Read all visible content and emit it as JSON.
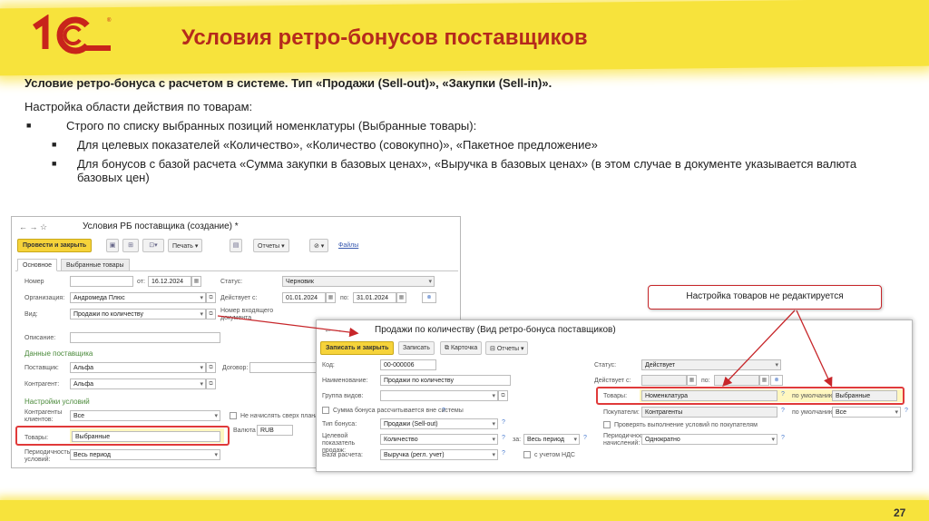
{
  "slide": {
    "title": "Условия ретро-бонусов поставщиков",
    "page_number": "27",
    "brand_colors": {
      "accent_yellow": "#f7e33c",
      "title_red": "#b52a1c",
      "highlight_red": "#e03a3a"
    }
  },
  "logo": {
    "text": "1С",
    "icon": "1c-logo-icon"
  },
  "intro": {
    "bold": "Условие ретро-бонуса с расчетом в системе. Тип «Продажи (Sell-out)», «Закупки (Sell-in)».",
    "para": "Настройка области действия по товарам:",
    "bullet1": "Строго по списку выбранных позиций номенклатуры (Выбранные товары):",
    "sub1": "Для целевых показателей «Количество», «Количество (совокупно)», «Пакетное предложение»",
    "sub2": "Для бонусов с базой расчета «Сумма закупки в базовых ценах», «Выручка в базовых ценах» (в этом случае в документе указывается валюта базовых цен)",
    "bullet_marker": "■"
  },
  "callout": "Настройка товаров не редактируется",
  "win1": {
    "title": "Условия РБ поставщика (создание) *",
    "nav": "←  →  ☆",
    "toolbar": {
      "post_close": "Провести и закрыть",
      "print": "Печать",
      "reports": "Отчеты",
      "files": "Файлы"
    },
    "tabs": {
      "main": "Основное",
      "goods": "Выбранные товары"
    },
    "labels": {
      "number": "Номер",
      "from": "от:",
      "status": "Статус:",
      "org": "Организация:",
      "active": "Действует с:",
      "to": "по:",
      "kind": "Вид:",
      "incoming": "Номер входящего документа",
      "desc": "Описание:",
      "supplier_data": "Данные поставщика",
      "supplier": "Поставщик:",
      "contract": "Договор:",
      "counterparty": "Контрагент:",
      "settings": "Настройки условий",
      "clients": "Контрагенты клиентов:",
      "goods": "Товары:",
      "period": "Периодичность условий:",
      "no_charge": "Не начислять сверх плана",
      "currency": "Валюта"
    },
    "values": {
      "date": "16.12.2024",
      "status": "Черновик",
      "org": "Андромеда Плюс",
      "from": "01.01.2024",
      "to": "31.01.2024",
      "kind": "Продажи по количеству",
      "supplier": "Альфа",
      "counterparty": "Альфа",
      "clients": "Все",
      "goods": "Выбранные",
      "period": "Весь период",
      "currency": "RUB"
    }
  },
  "win2": {
    "title": "Продажи по количеству (Вид ретро-бонуса поставщиков)",
    "nav": "←  →",
    "toolbar": {
      "save_close": "Записать и закрыть",
      "save": "Записать",
      "card": "Карточка",
      "reports": "Отчеты"
    },
    "labels": {
      "code": "Код:",
      "name": "Наименование:",
      "group": "Группа видов:",
      "calc": "Сумма бонуса рассчитывается вне системы",
      "type": "Тип бонуса:",
      "target": "Целевой показатель продаж:",
      "base": "База расчета:",
      "status": "Статус:",
      "active": "Действует с:",
      "to": "по:",
      "goods": "Товары:",
      "buyers": "Покупатели:",
      "default": "по умолчанию:",
      "check": "Проверять выполнение условий по покупателям",
      "period": "Периодичность начислений:",
      "rev": "за:",
      "vat": "с учетом НДС",
      "q": "?"
    },
    "values": {
      "code": "00-000006",
      "name": "Продажи по количеству",
      "type": "Продажи (Sell-out)",
      "target": "Количество",
      "period_unit": "Весь период",
      "base": "Выручка (регл. учет)",
      "status": "Действует",
      "goods": "Номенклатура",
      "goods_default": "Выбранные",
      "buyers": "Контрагенты",
      "buyers_default": "Все",
      "period": "Однократно"
    }
  }
}
